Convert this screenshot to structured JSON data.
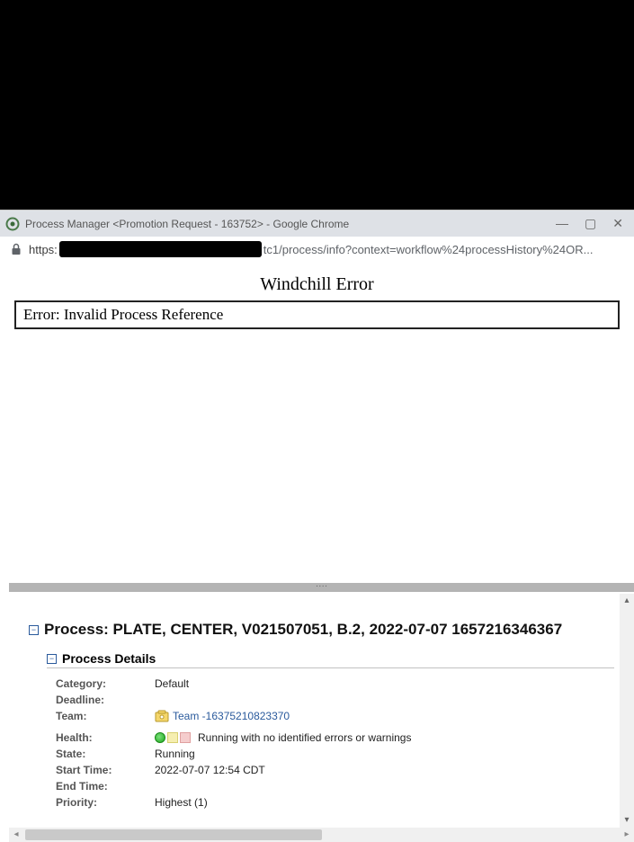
{
  "chrome": {
    "window_title": "Process Manager <Promotion Request - 163752> - Google Chrome",
    "url_scheme": "https:",
    "url_rest": "tc1/process/info?context=workflow%24processHistory%24OR..."
  },
  "error": {
    "title": "Windchill Error",
    "message": "Error: Invalid Process Reference"
  },
  "process": {
    "heading": "Process: PLATE, CENTER, V021507051, B.2, 2022-07-07 1657216346367",
    "section_title": "Process Details",
    "rows": {
      "category_label": "Category:",
      "category_value": "Default",
      "deadline_label": "Deadline:",
      "deadline_value": "",
      "team_label": "Team:",
      "team_link": "Team -16375210823370",
      "health_label": "Health:",
      "health_value": "Running with no identified errors or warnings",
      "state_label": "State:",
      "state_value": "Running",
      "start_label": "Start Time:",
      "start_value": "2022-07-07 12:54 CDT",
      "end_label": "End Time:",
      "end_value": "",
      "priority_label": "Priority:",
      "priority_value": "Highest (1)"
    }
  }
}
